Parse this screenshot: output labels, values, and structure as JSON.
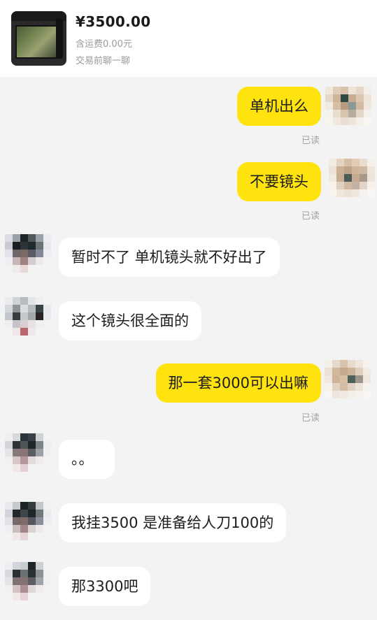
{
  "product": {
    "price": "¥3500.00",
    "shipping": "含运费0.00元",
    "chat_hint": "交易前聊一聊"
  },
  "messages": [
    {
      "side": "me",
      "text": "单机出么",
      "status": "已读"
    },
    {
      "side": "me",
      "text": "不要镜头",
      "status": "已读"
    },
    {
      "side": "them",
      "text": "暂时不了 单机镜头就不好出了"
    },
    {
      "side": "them",
      "text": "这个镜头很全面的"
    },
    {
      "side": "me",
      "text": "那一套3000可以出嘛",
      "status": "已读"
    },
    {
      "side": "them",
      "text": "。。"
    },
    {
      "side": "them",
      "text": "我挂3500 是准备给人刀100的"
    },
    {
      "side": "them",
      "text": "那3300吧"
    }
  ],
  "colors": {
    "my_bubble": "#ffe30f",
    "their_bubble": "#ffffff",
    "background": "#f3f3f3"
  }
}
